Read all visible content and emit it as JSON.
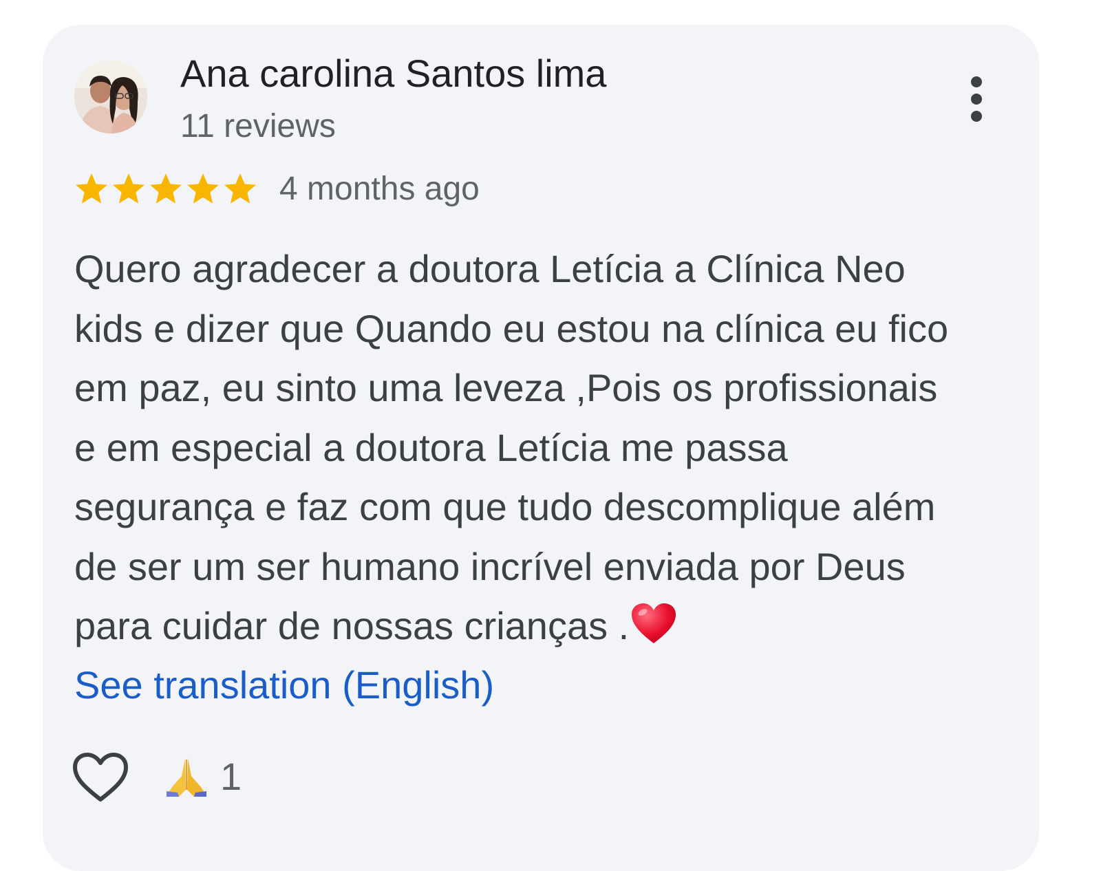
{
  "review": {
    "author_name": "Ana carolina Santos lima",
    "review_count": "11 reviews",
    "rating": 5,
    "rating_max": 5,
    "date": "4 months ago",
    "text_lines": [
      "Quero agradecer a doutora Letícia a Clínica Neo",
      "kids e dizer que Quando eu estou na clínica eu fico",
      "em paz, eu sinto uma leveza ,Pois os profissionais",
      "e em especial a doutora Letícia me passa",
      "segurança e faz com que tudo descomplique além",
      "de ser um ser humano incrível enviada por Deus",
      "para cuidar de nossas crianças ."
    ],
    "translation_link": "See translation (English)",
    "reaction_count": "1"
  },
  "icons": {
    "avatar": "avatar-photo",
    "more": "more-vert-icon",
    "star": "star-icon",
    "heart_emoji": "red-heart-emoji",
    "like": "heart-outline-icon",
    "reaction": "folded-hands-emoji"
  },
  "colors": {
    "card_background": "#f3f4f7",
    "star": "#f9b600",
    "link": "#1a5dc8",
    "primary_text": "#202124",
    "secondary_text": "#5f6368",
    "body_text": "#3c4043"
  }
}
